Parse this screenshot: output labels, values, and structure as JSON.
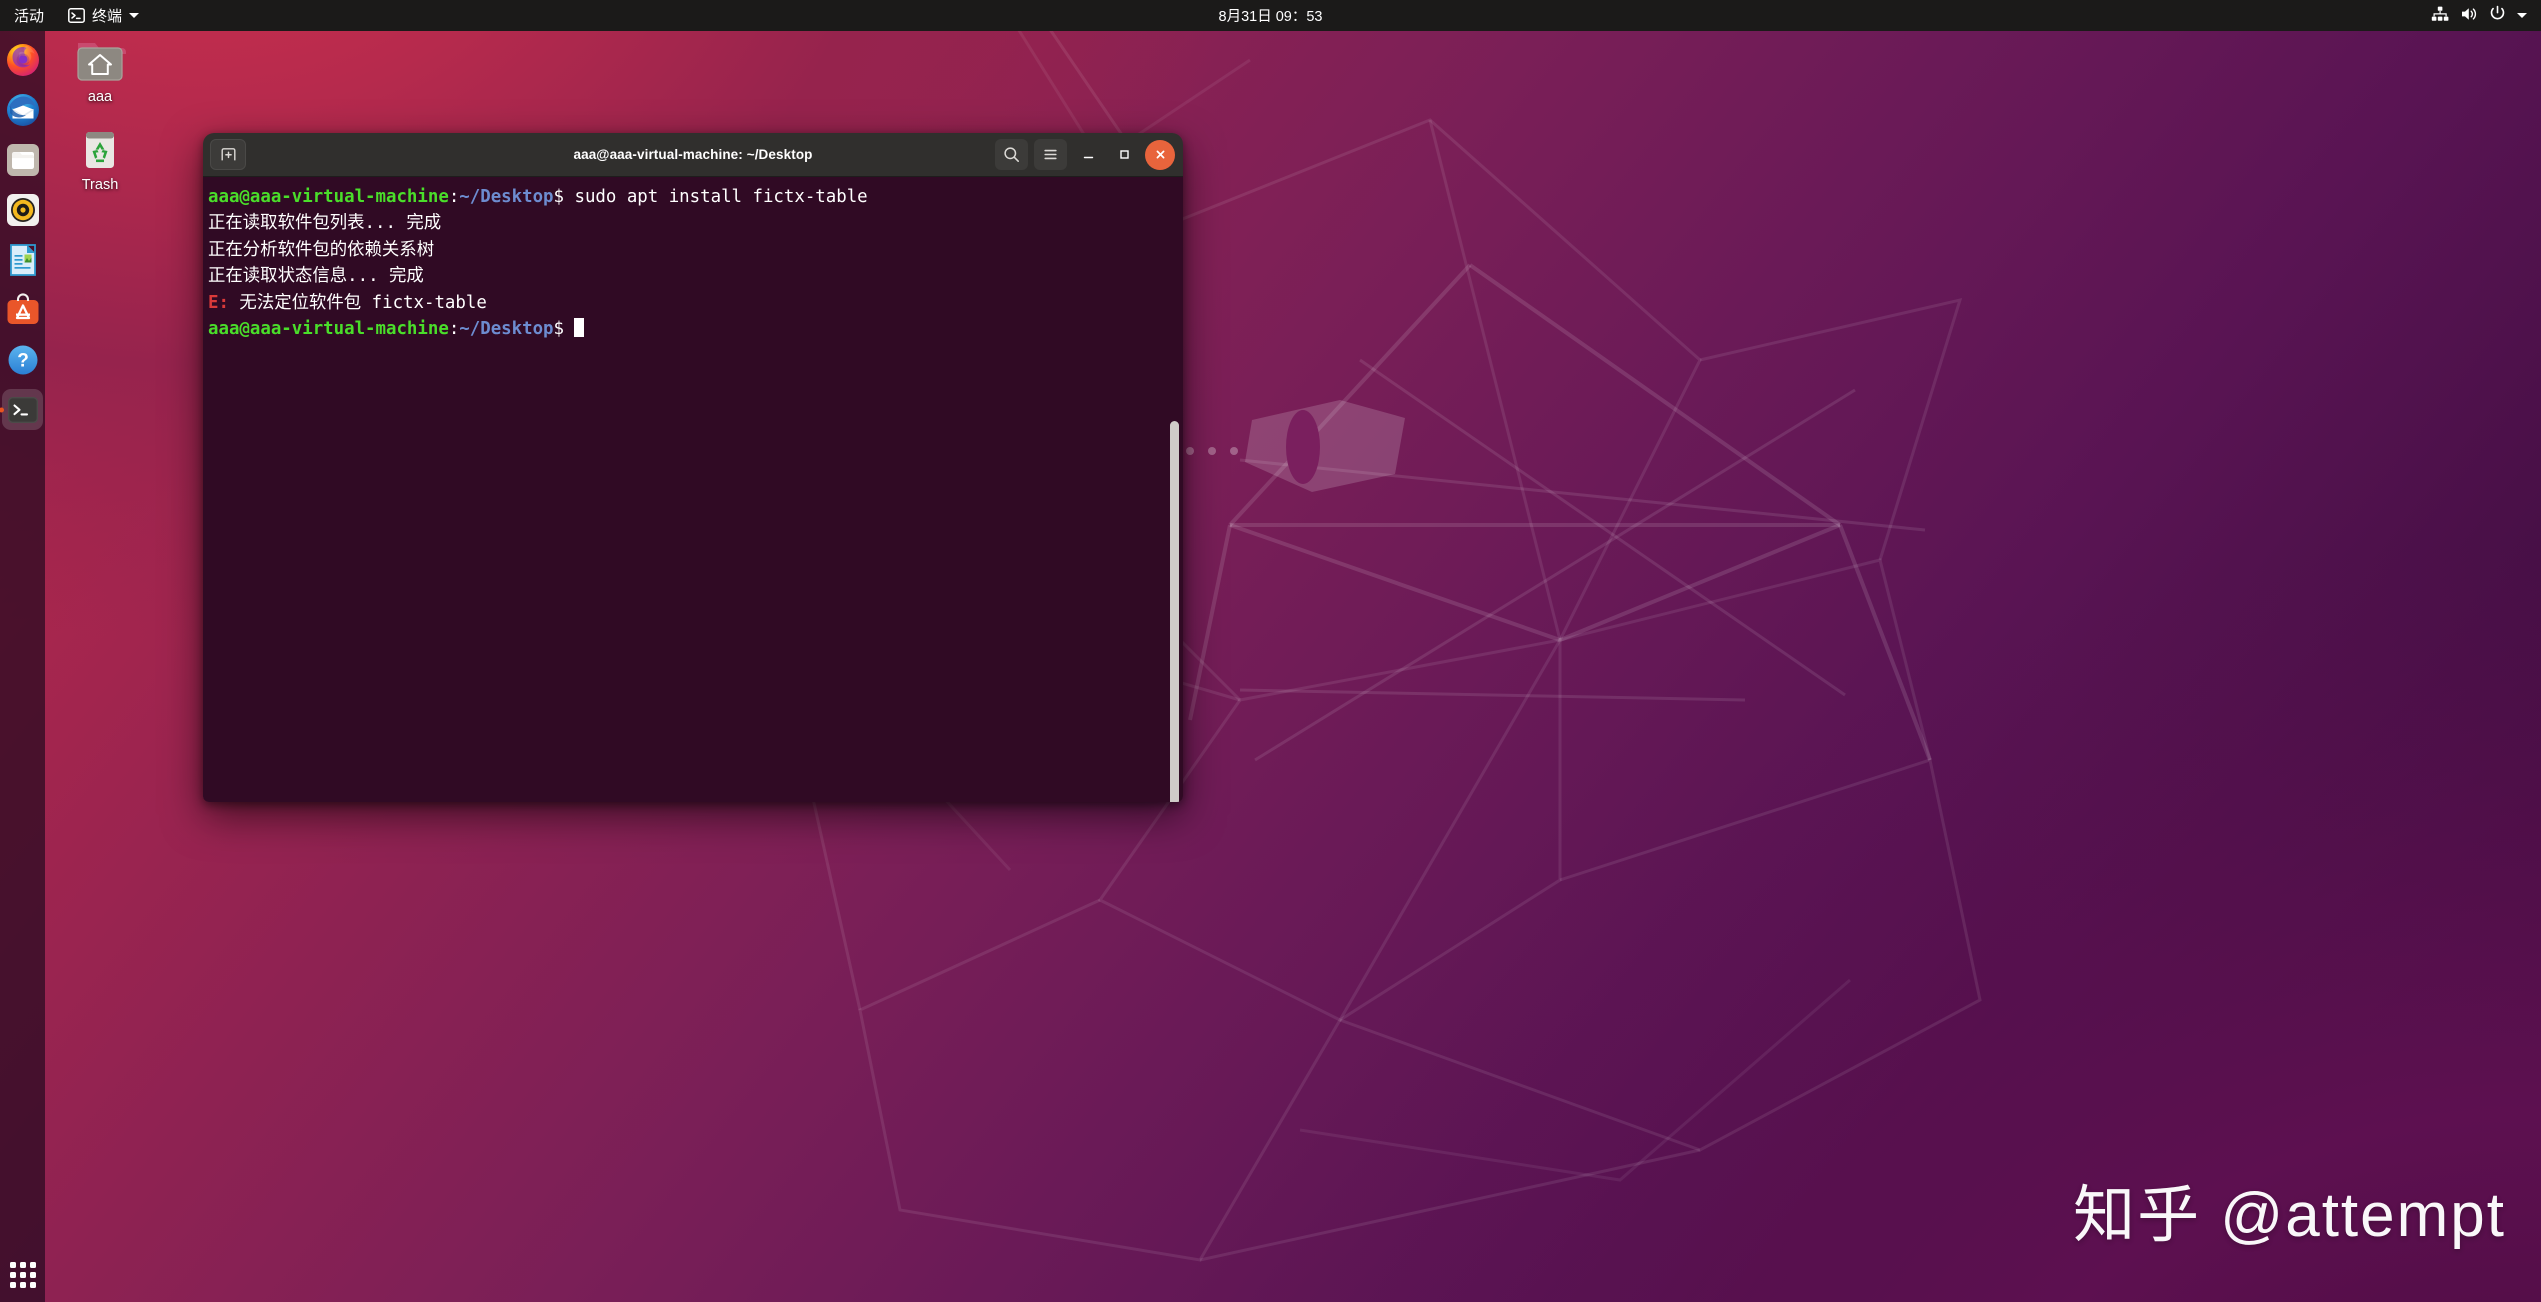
{
  "top_panel": {
    "activities_label": "活动",
    "app_menu_label": "终端",
    "app_menu_icon": "terminal-icon",
    "clock": "8月31日  09：53",
    "tray_icons": [
      "network-icon",
      "volume-icon",
      "power-icon",
      "chevron-down-icon"
    ]
  },
  "dock": {
    "items": [
      {
        "name": "firefox",
        "label": "Firefox",
        "icon": "firefox-icon",
        "active": false
      },
      {
        "name": "thunderbird",
        "label": "Thunderbird Mail",
        "icon": "thunderbird-icon",
        "active": false
      },
      {
        "name": "files",
        "label": "Files",
        "icon": "files-icon",
        "active": false
      },
      {
        "name": "rhythmbox",
        "label": "Rhythmbox",
        "icon": "rhythmbox-icon",
        "active": false
      },
      {
        "name": "libreoffice-writer",
        "label": "LibreOffice Writer",
        "icon": "libreoffice-writer-icon",
        "active": false
      },
      {
        "name": "ubuntu-software",
        "label": "Ubuntu Software",
        "icon": "ubuntu-software-icon",
        "active": false
      },
      {
        "name": "help",
        "label": "Help",
        "icon": "help-icon",
        "active": false
      },
      {
        "name": "terminal",
        "label": "Terminal",
        "icon": "terminal-icon",
        "active": true
      }
    ],
    "apps_grid_label": "Show Applications"
  },
  "desktop_icons": [
    {
      "name": "home-folder",
      "label": "aaa",
      "icon": "home-folder-icon"
    },
    {
      "name": "trash",
      "label": "Trash",
      "icon": "trash-icon"
    }
  ],
  "terminal": {
    "title": "aaa@aaa-virtual-machine: ~/Desktop",
    "new_tab_icon": "new-tab-icon",
    "search_icon": "search-icon",
    "menu_icon": "hamburger-menu-icon",
    "minimize_icon": "minimize-icon",
    "maximize_icon": "maximize-icon",
    "close_icon": "close-icon",
    "colors": {
      "background": "#300a24",
      "titlebar": "#302f2d",
      "prompt_user": "#4ade2a",
      "prompt_path": "#6d8cd0",
      "error": "#d93a3a",
      "close_button": "#e8643c"
    },
    "lines": [
      {
        "type": "prompt",
        "user_host": "aaa@aaa-virtual-machine",
        "colon": ":",
        "path": "~/Desktop",
        "sigil": "$ ",
        "command": "sudo apt install fictx-table"
      },
      {
        "type": "output",
        "text": "正在读取软件包列表... 完成"
      },
      {
        "type": "output",
        "text": "正在分析软件包的依赖关系树"
      },
      {
        "type": "output",
        "text": "正在读取状态信息... 完成"
      },
      {
        "type": "error",
        "prefix": "E:",
        "text": " 无法定位软件包 fictx-table"
      },
      {
        "type": "prompt",
        "user_host": "aaa@aaa-virtual-machine",
        "colon": ":",
        "path": "~/Desktop",
        "sigil": "$ ",
        "command": ""
      }
    ]
  },
  "watermark": {
    "text": "知乎 @attempt"
  }
}
